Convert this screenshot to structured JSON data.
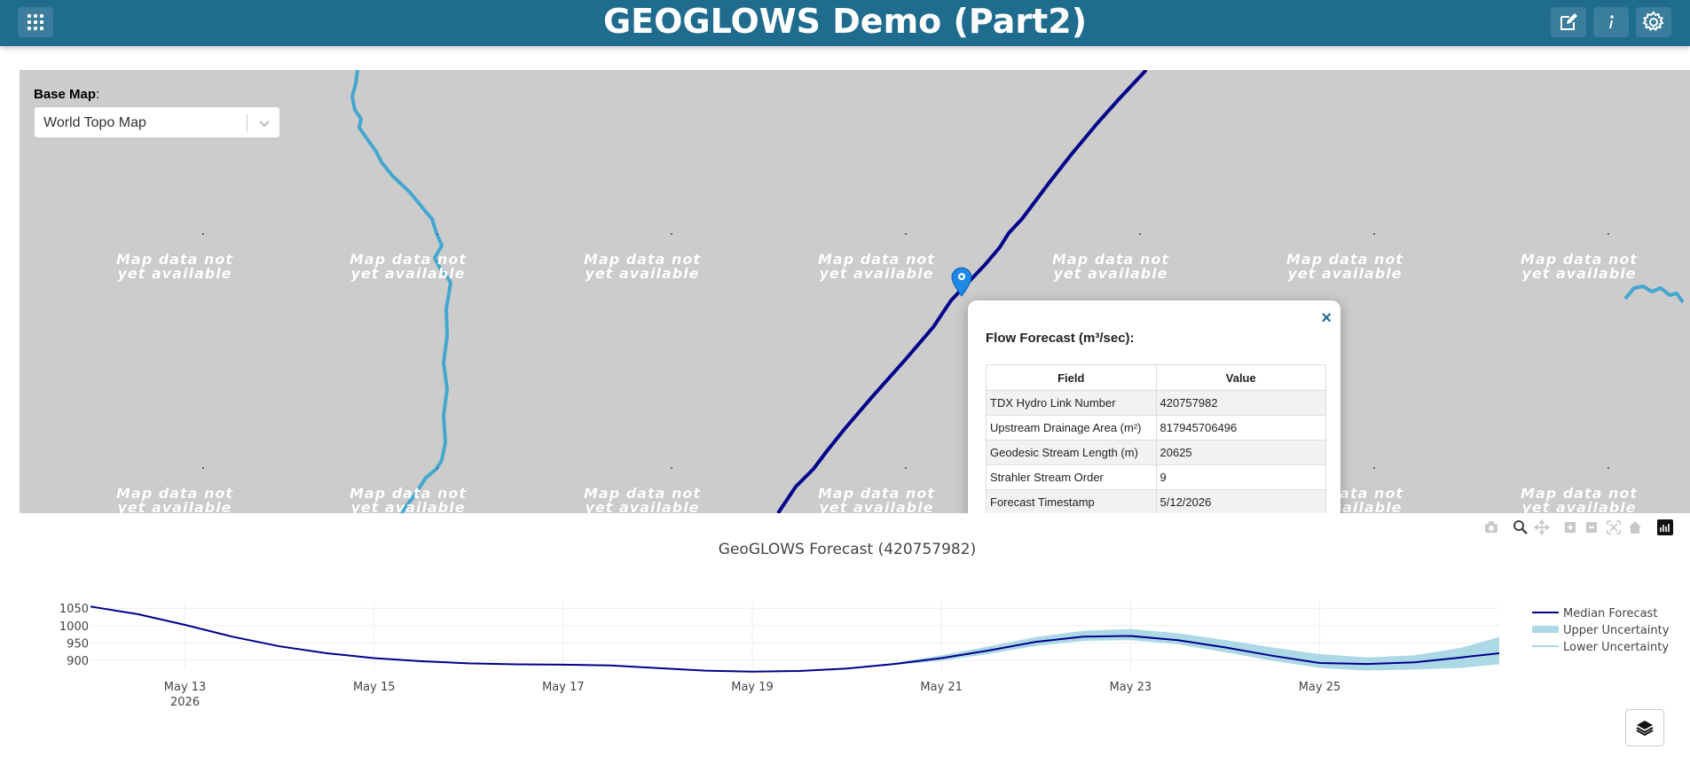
{
  "header": {
    "title": "GEOGLOWS Demo (Part2)",
    "icons": [
      "apps-grid-icon",
      "edit-icon",
      "info-icon",
      "settings-gear-icon"
    ]
  },
  "map": {
    "tile_notice": "Map data not yet available",
    "basemap_label": "Base Map",
    "basemap_value": "World Topo Map",
    "marker": "location-pin-icon",
    "colors": {
      "main_river": "#00008b",
      "tributary": "#43a7cf",
      "map_background": "#cccccc"
    }
  },
  "popup": {
    "title": "Flow Forecast (m³/sec):",
    "headers": {
      "field": "Field",
      "value": "Value"
    },
    "rows": [
      {
        "field": "TDX Hydro Link Number",
        "value": "420757982"
      },
      {
        "field": "Upstream Drainage Area (m²)",
        "value": "817945706496"
      },
      {
        "field": "Geodesic Stream Length (m)",
        "value": "20625"
      },
      {
        "field": "Strahler Stream Order",
        "value": "9"
      },
      {
        "field": "Forecast Timestamp",
        "value": "5/12/2026"
      }
    ]
  },
  "chart_data": {
    "type": "line",
    "title": "GeoGLOWS Forecast (420757982)",
    "x_ticks": [
      {
        "label": "May 13",
        "sublabel": "2026",
        "day": 13
      },
      {
        "label": "May 15",
        "day": 15
      },
      {
        "label": "May 17",
        "day": 17
      },
      {
        "label": "May 19",
        "day": 19
      },
      {
        "label": "May 21",
        "day": 21
      },
      {
        "label": "May 23",
        "day": 23
      },
      {
        "label": "May 25",
        "day": 25
      }
    ],
    "xlim_days": [
      12,
      26.9
    ],
    "y_ticks": [
      900,
      950,
      1000,
      1050
    ],
    "ylim": [
      874,
      1071
    ],
    "x_days": [
      12.0,
      12.5,
      13.0,
      13.5,
      14.0,
      14.5,
      15.0,
      15.5,
      16.0,
      16.5,
      17.0,
      17.5,
      18.0,
      18.5,
      19.0,
      19.5,
      20.0,
      20.5,
      21.0,
      21.5,
      22.0,
      22.5,
      23.0,
      23.5,
      24.0,
      24.5,
      25.0,
      25.5,
      26.0,
      26.5,
      26.9
    ],
    "series": [
      {
        "name": "Median Forecast",
        "color": "#00008b",
        "values": [
          1055,
          1033,
          1002,
          968,
          940,
          920,
          906,
          897,
          891,
          888,
          887,
          885,
          877,
          870,
          867,
          869,
          876,
          889,
          906,
          928,
          953,
          968,
          970,
          958,
          937,
          913,
          892,
          889,
          894,
          908,
          920
        ]
      },
      {
        "name": "Upper Uncertainty",
        "color": "#add8e6",
        "values": [
          1055,
          1033,
          1002,
          968,
          940,
          920,
          906,
          897,
          891,
          888,
          887,
          885,
          877,
          870,
          867,
          869,
          876,
          890,
          912,
          938,
          965,
          983,
          988,
          976,
          956,
          935,
          916,
          906,
          912,
          934,
          965
        ]
      },
      {
        "name": "Lower Uncertainty",
        "color": "#add8e6",
        "values": [
          1055,
          1033,
          1002,
          968,
          940,
          920,
          906,
          897,
          891,
          888,
          887,
          885,
          877,
          870,
          867,
          869,
          876,
          888,
          900,
          920,
          943,
          958,
          960,
          948,
          925,
          900,
          880,
          872,
          875,
          880,
          890
        ]
      }
    ],
    "legend": [
      "Median Forecast",
      "Upper Uncertainty",
      "Lower Uncertainty"
    ],
    "legend_position": "right",
    "grid": true
  },
  "chart_toolbar": {
    "icons": [
      "camera-icon",
      "zoom-icon",
      "pan-icon",
      "zoom-in-icon",
      "zoom-out-icon",
      "autoscale-icon",
      "reset-axes-icon",
      "plotly-logo-icon"
    ]
  },
  "layers_control": {
    "icon": "layers-icon"
  }
}
